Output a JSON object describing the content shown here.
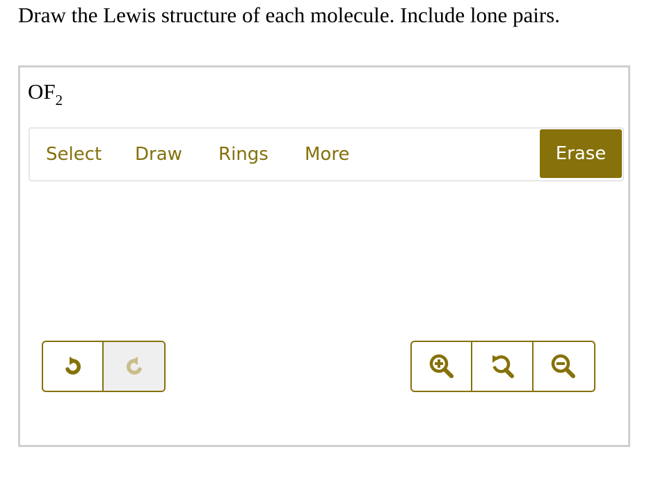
{
  "question": {
    "prompt": "Draw the Lewis structure of each molecule. Include lone pairs."
  },
  "molecule": {
    "formula_main": "OF",
    "formula_subscript": "2"
  },
  "toolbar": {
    "select_label": "Select",
    "draw_label": "Draw",
    "rings_label": "Rings",
    "more_label": "More",
    "erase_label": "Erase"
  },
  "history_controls": {
    "undo_icon": "undo-icon",
    "redo_icon": "redo-icon",
    "redo_enabled": false
  },
  "zoom_controls": {
    "zoom_in_icon": "zoom-in-icon",
    "zoom_reset_icon": "zoom-reset-icon",
    "zoom_out_icon": "zoom-out-icon"
  },
  "colors": {
    "accent": "#86710a",
    "accent_text": "#84700b",
    "disabled_icon": "#c9bd8a",
    "panel_border": "#cfcfcf"
  }
}
